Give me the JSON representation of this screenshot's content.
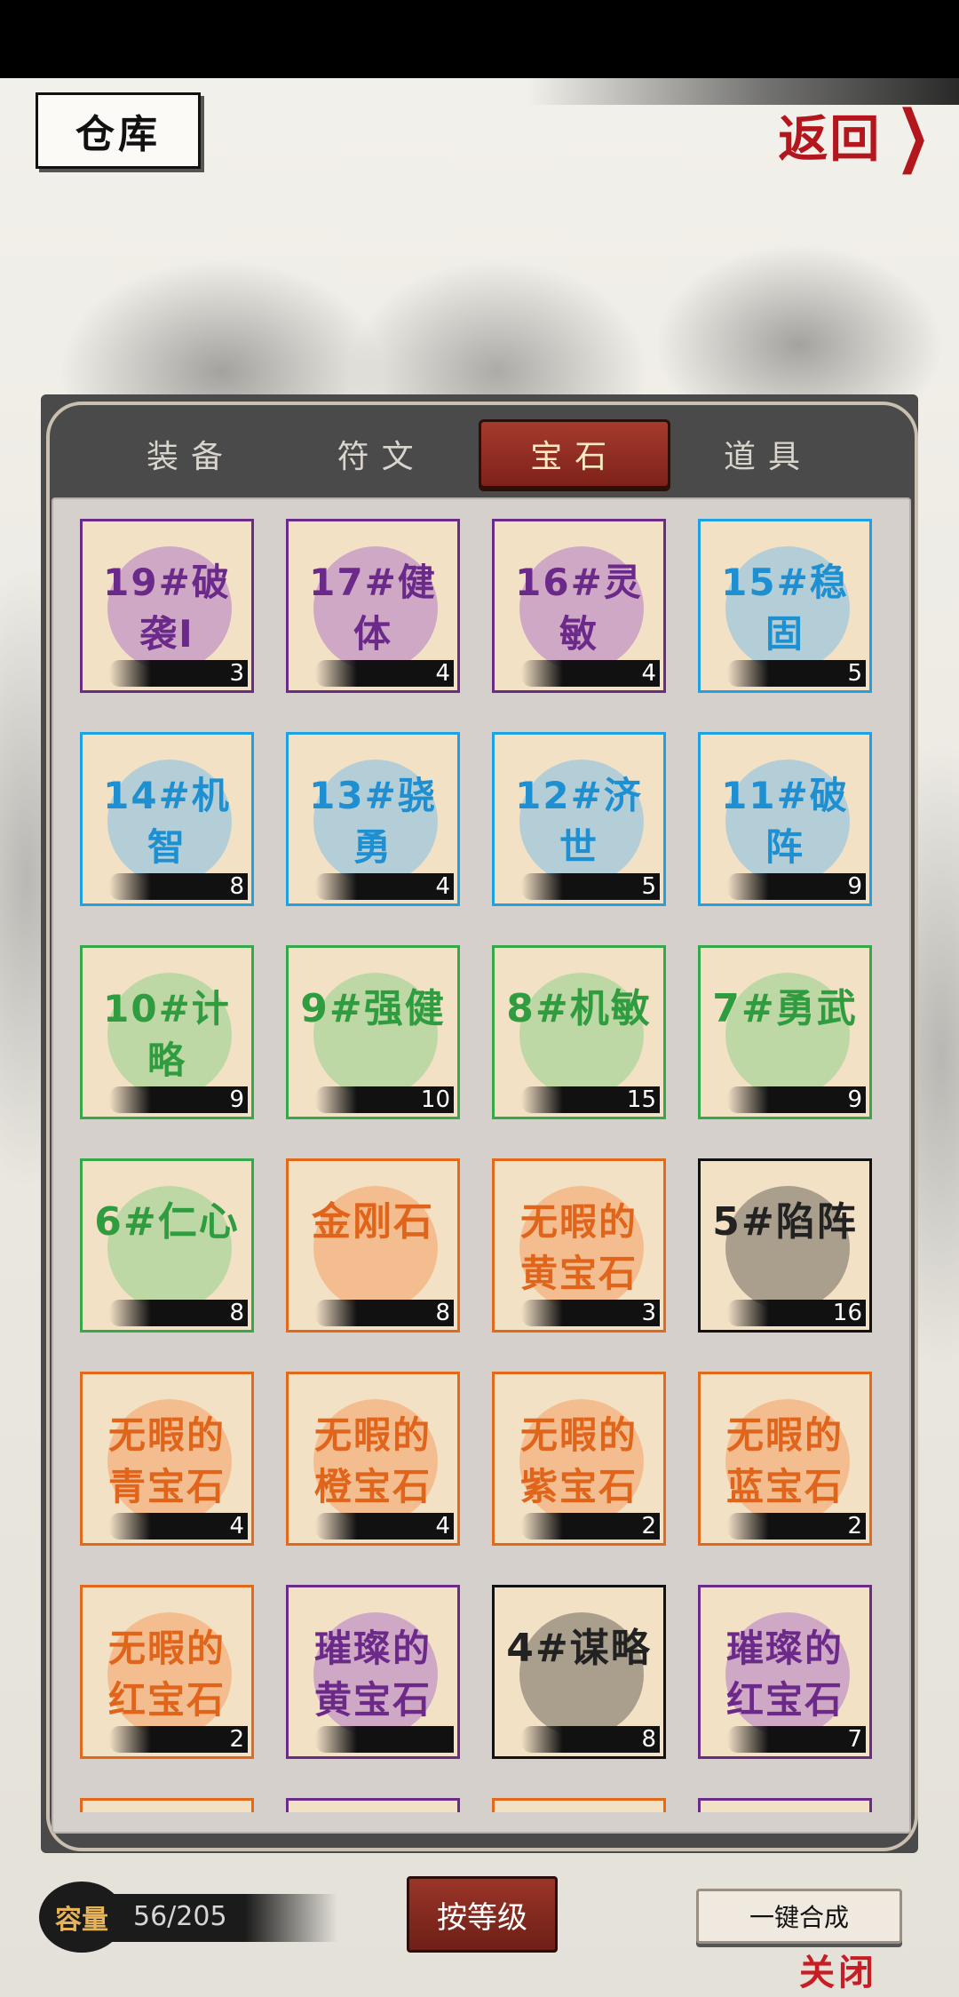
{
  "header": {
    "title": "仓库",
    "back_label": "返回"
  },
  "tabs": [
    {
      "label": "装备",
      "active": false
    },
    {
      "label": "符文",
      "active": false
    },
    {
      "label": "宝石",
      "active": true
    },
    {
      "label": "道具",
      "active": false
    }
  ],
  "items": [
    {
      "name": "19#破袭I",
      "count": "3",
      "rarity": "purple"
    },
    {
      "name": "17#健体",
      "count": "4",
      "rarity": "purple"
    },
    {
      "name": "16#灵敏",
      "count": "4",
      "rarity": "purple"
    },
    {
      "name": "15#稳固",
      "count": "5",
      "rarity": "blue"
    },
    {
      "name": "14#机智",
      "count": "8",
      "rarity": "blue"
    },
    {
      "name": "13#骁勇",
      "count": "4",
      "rarity": "blue"
    },
    {
      "name": "12#济世",
      "count": "5",
      "rarity": "blue"
    },
    {
      "name": "11#破阵",
      "count": "9",
      "rarity": "blue"
    },
    {
      "name": "10#计略",
      "count": "9",
      "rarity": "green"
    },
    {
      "name": "9#强健",
      "count": "10",
      "rarity": "green"
    },
    {
      "name": "8#机敏",
      "count": "15",
      "rarity": "green"
    },
    {
      "name": "7#勇武",
      "count": "9",
      "rarity": "green"
    },
    {
      "name": "6#仁心",
      "count": "8",
      "rarity": "green"
    },
    {
      "name": "金刚石",
      "count": "8",
      "rarity": "orange"
    },
    {
      "name": "无暇的黄宝石",
      "count": "3",
      "rarity": "orange"
    },
    {
      "name": "5#陷阵",
      "count": "16",
      "rarity": "black"
    },
    {
      "name": "无暇的青宝石",
      "count": "4",
      "rarity": "orange"
    },
    {
      "name": "无暇的橙宝石",
      "count": "4",
      "rarity": "orange"
    },
    {
      "name": "无暇的紫宝石",
      "count": "2",
      "rarity": "orange"
    },
    {
      "name": "无暇的蓝宝石",
      "count": "2",
      "rarity": "orange"
    },
    {
      "name": "无暇的红宝石",
      "count": "2",
      "rarity": "orange"
    },
    {
      "name": "璀璨的黄宝石",
      "count": "",
      "rarity": "purple"
    },
    {
      "name": "4#谋略",
      "count": "8",
      "rarity": "black"
    },
    {
      "name": "璀璨的红宝石",
      "count": "7",
      "rarity": "purple"
    }
  ],
  "footer": {
    "capacity_label": "容量",
    "capacity_value": "56/205",
    "sort_label": "按等级",
    "merge_label": "一键合成",
    "close_label": "关闭"
  },
  "colors": {
    "purple": "#6a2c87",
    "blue": "#1ea2e4",
    "green": "#35a84a",
    "orange": "#e2691a",
    "black": "#111111",
    "active_tab": "#8e2b20"
  }
}
